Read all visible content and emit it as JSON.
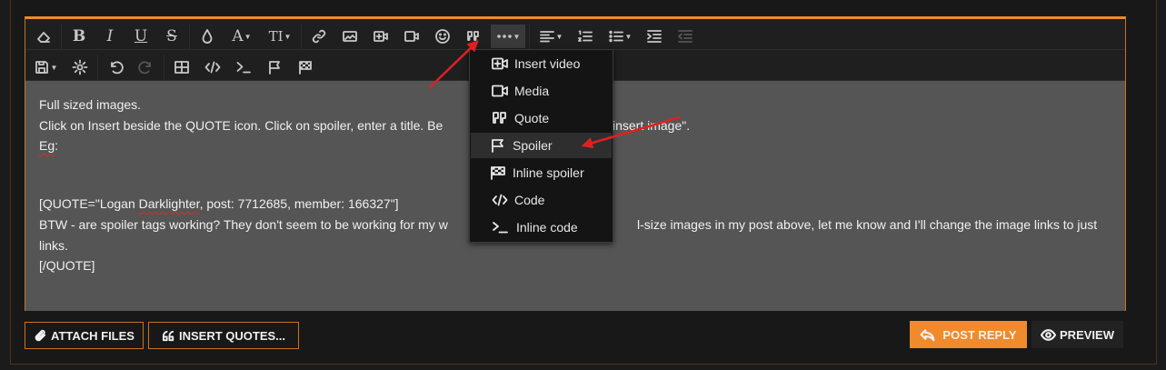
{
  "toolbar": {
    "row1": [
      "eraser-icon",
      "bold-icon",
      "italic-icon",
      "underline-icon",
      "strikethrough-icon",
      "color-drop-icon",
      "font-family-icon",
      "font-size-icon",
      "link-icon",
      "image-icon",
      "insert-video-icon",
      "media-icon",
      "smilie-icon",
      "quote-icon",
      "more-insert-icon",
      "align-icon",
      "ordered-list-icon",
      "unordered-list-icon",
      "indent-icon",
      "outdent-icon"
    ],
    "row2": [
      "drafts-icon",
      "settings-icon",
      "undo-icon",
      "redo-icon",
      "table-icon",
      "code-icon",
      "inline-code-icon",
      "spoiler-icon",
      "inline-spoiler-icon"
    ]
  },
  "editor": {
    "lines": [
      "Full sized images.",
      "Click on Insert beside the QUOTE icon. Click on spoiler, enter a title. Be",
      "Eg:",
      "[QUOTE=\"Logan ",
      "Darklighter",
      ", post: 7712685, member: 166327\"]",
      "BTW - are spoiler tags working? They don't seem to be working for my w",
      "l-size images in my post above, let me know and I'll change the image links to just",
      "links.",
      "[/QUOTE]",
      "\"insert image\".",
      "Eg"
    ]
  },
  "insert_menu": {
    "items": [
      {
        "label": "Insert video",
        "icon": "insert-video-icon"
      },
      {
        "label": "Media",
        "icon": "media-icon"
      },
      {
        "label": "Quote",
        "icon": "quote-icon"
      },
      {
        "label": "Spoiler",
        "icon": "spoiler-flag-icon"
      },
      {
        "label": "Inline spoiler",
        "icon": "inline-spoiler-icon"
      },
      {
        "label": "Code",
        "icon": "code-icon"
      },
      {
        "label": "Inline code",
        "icon": "terminal-icon"
      }
    ],
    "highlighted": "Spoiler"
  },
  "buttons": {
    "attach": "ATTACH FILES",
    "insert_quotes": "INSERT QUOTES...",
    "post_reply": "POST REPLY",
    "preview": "PREVIEW"
  },
  "colors": {
    "accent": "#f08a2a",
    "annotation_arrow": "#e02020"
  }
}
